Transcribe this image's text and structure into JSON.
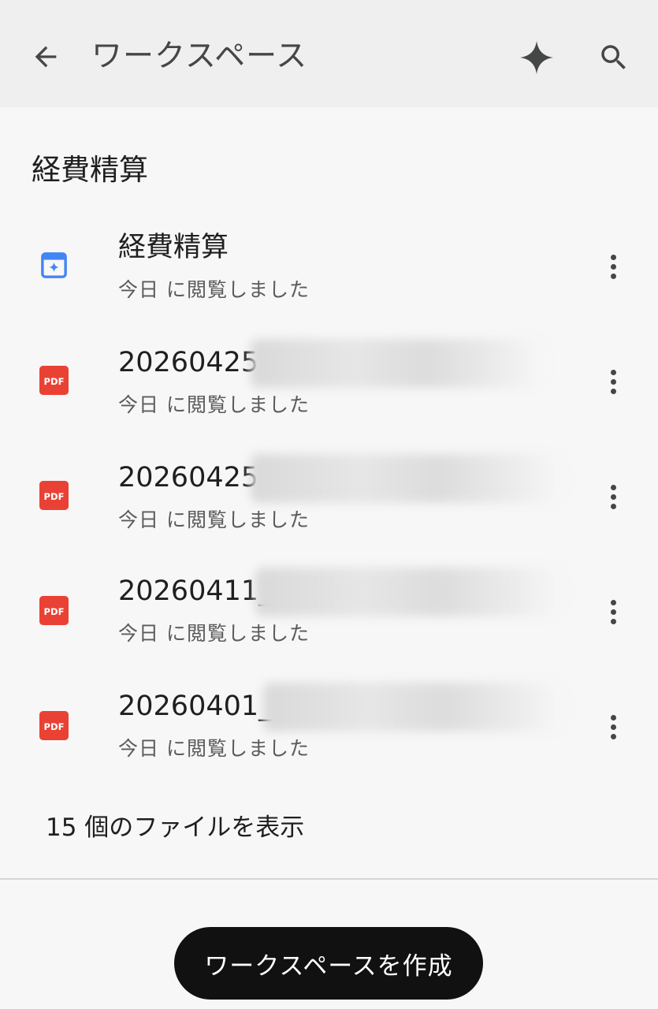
{
  "appbar": {
    "title": "ワークスペース",
    "icons": {
      "back": "arrow-left-icon",
      "gemini": "sparkle-icon",
      "search": "search-icon"
    }
  },
  "section": {
    "title": "経費精算"
  },
  "files": [
    {
      "name": "経費精算",
      "sub": "今日 に閲覧しました",
      "icon": "workspace-doc-icon"
    },
    {
      "name": "20260425",
      "sub": "今日 に閲覧しました",
      "icon": "pdf-icon"
    },
    {
      "name": "20260425",
      "sub": "今日 に閲覧しました",
      "icon": "pdf-icon"
    },
    {
      "name": "20260411_",
      "sub": "今日 に閲覧しました",
      "icon": "pdf-icon"
    },
    {
      "name": "20260401_",
      "sub": "今日 に閲覧しました",
      "icon": "pdf-icon"
    }
  ],
  "pdf_badge": "PDF",
  "show_all": "15 個のファイルを表示",
  "create_button": "ワークスペースを作成",
  "colors": {
    "pdf": "#e94235",
    "workspace": "#4285f4",
    "fab": "#111111"
  }
}
